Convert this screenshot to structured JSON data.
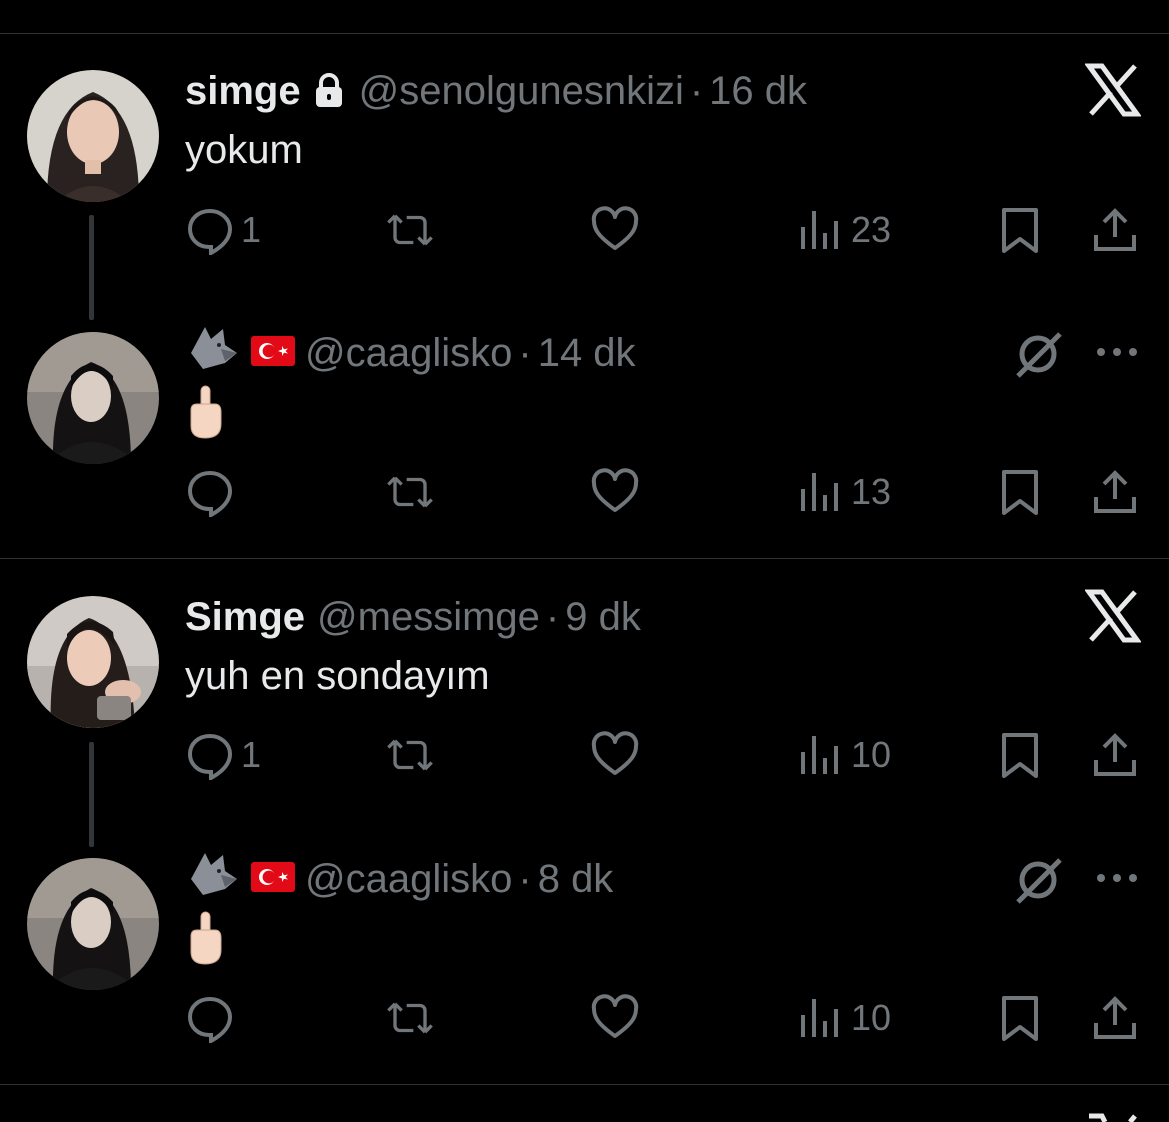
{
  "tweets": [
    {
      "name": "simge",
      "handle": "@senolgunesnkizi",
      "time": "16 dk",
      "text": "yokum",
      "reply_count": "1",
      "views": "23",
      "locked": true,
      "top_icon": "x-logo-icon"
    },
    {
      "name": "",
      "handle": "@caaglisko",
      "time": "14 dk",
      "text": "",
      "reply_count": "",
      "views": "13",
      "top_icon": "grok-icon"
    },
    {
      "name": "Simge",
      "handle": "@messimge",
      "time": "9 dk",
      "text": "yuh en sondayım",
      "reply_count": "1",
      "views": "10",
      "top_icon": "x-logo-icon"
    },
    {
      "name": "",
      "handle": "@caaglisko",
      "time": "8 dk",
      "text": "",
      "reply_count": "",
      "views": "10",
      "top_icon": "grok-icon"
    }
  ],
  "separator": "·",
  "colors": {
    "background": "#000000",
    "text": "#e7e9ea",
    "muted": "#71767b",
    "divider": "#2f3336"
  }
}
